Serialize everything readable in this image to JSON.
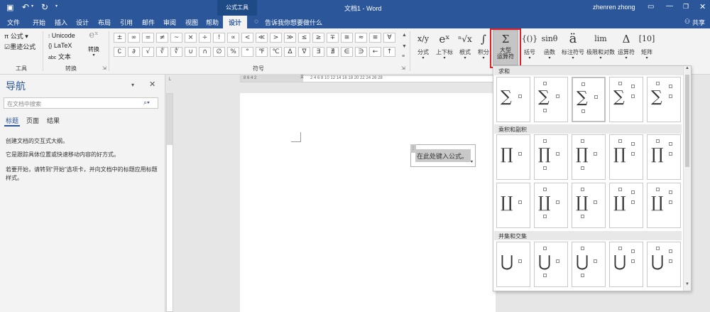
{
  "titlebar": {
    "save_icon": "save-icon",
    "undo_icon": "undo-icon",
    "redo_icon": "redo-icon",
    "context_tab": "公式工具",
    "doc_title": "文档1 - Word",
    "user": "zhenren zhong",
    "share": "共享"
  },
  "tabs": [
    {
      "label": "文件"
    },
    {
      "label": "开始"
    },
    {
      "label": "插入"
    },
    {
      "label": "设计"
    },
    {
      "label": "布局"
    },
    {
      "label": "引用"
    },
    {
      "label": "邮件"
    },
    {
      "label": "审阅"
    },
    {
      "label": "视图"
    },
    {
      "label": "帮助"
    },
    {
      "label": "设计"
    }
  ],
  "tell_me": "告诉我你想要做什么",
  "ribbon": {
    "tools": {
      "equation": "公式",
      "ink": "墨迹公式",
      "group": "工具"
    },
    "convert": {
      "unicode": "Unicode",
      "latex": "LaTeX",
      "text": "文本",
      "convert": "转换",
      "group": "转换"
    },
    "symbols": {
      "group": "符号",
      "row1": [
        "±",
        "∞",
        "=",
        "≠",
        "~",
        "×",
        "÷",
        "!",
        "∝",
        "<",
        "≪",
        ">",
        "≫",
        "≤",
        "≥",
        "∓",
        "≅",
        "≈",
        "≡",
        "∀"
      ],
      "row2": [
        "∁",
        "∂",
        "√",
        "∛",
        "∜",
        "∪",
        "∩",
        "∅",
        "%",
        "°",
        "℉",
        "℃",
        "∆",
        "∇",
        "∃",
        "∄",
        "∈",
        "∋",
        "←",
        "↑"
      ]
    },
    "structures": [
      {
        "glyph": "x/y",
        "label": "分式"
      },
      {
        "glyph": "eˣ",
        "label": "上下标"
      },
      {
        "glyph": "ⁿ√x",
        "label": "根式"
      },
      {
        "glyph": "∫",
        "label": "积分"
      },
      {
        "glyph": "Σ",
        "label_line1": "大型",
        "label_line2": "运算符"
      },
      {
        "glyph": "{()}",
        "label": "括号"
      },
      {
        "glyph": "sinθ",
        "label": "函数"
      },
      {
        "glyph": "ä",
        "label": "标注符号"
      },
      {
        "glyph": "lim",
        "label": "极限和对数"
      },
      {
        "glyph": "Δ",
        "label": "运算符"
      },
      {
        "glyph": "[10]",
        "label": "矩阵"
      }
    ]
  },
  "nav": {
    "title": "导航",
    "search_placeholder": "在文档中搜索",
    "tabs": [
      "标题",
      "页面",
      "结果"
    ],
    "line1": "创建文档的交互式大纲。",
    "line2": "它是跟踪具体位置或快速移动内容的好方式。",
    "line3a": "若要开始，请转到\"开始\"选项卡，并向文档中的标题应用标题",
    "line3b": "样式。"
  },
  "ruler": {
    "h_left": "8  6  4  2",
    "h_right": "2  4  6  8  10  12  14  16  18  20  22  24  26  28"
  },
  "equation_box": {
    "placeholder": "在此处键入公式。"
  },
  "gallery": {
    "header": "求和",
    "cat_product": "乘积和副积",
    "cat_union": "并集和交集",
    "row_sum": [
      "∑",
      "∑",
      "∑",
      "∑",
      "∑"
    ],
    "row_prod": [
      "∏",
      "∏",
      "∏",
      "∏",
      "∏"
    ],
    "row_coprod": [
      "∐",
      "∐",
      "∐",
      "∐",
      "∐"
    ],
    "row_union": [
      "⋃",
      "⋃",
      "⋃",
      "⋃",
      "⋃"
    ]
  },
  "colors": {
    "accent": "#2b579a",
    "highlight": "#e21f26"
  }
}
